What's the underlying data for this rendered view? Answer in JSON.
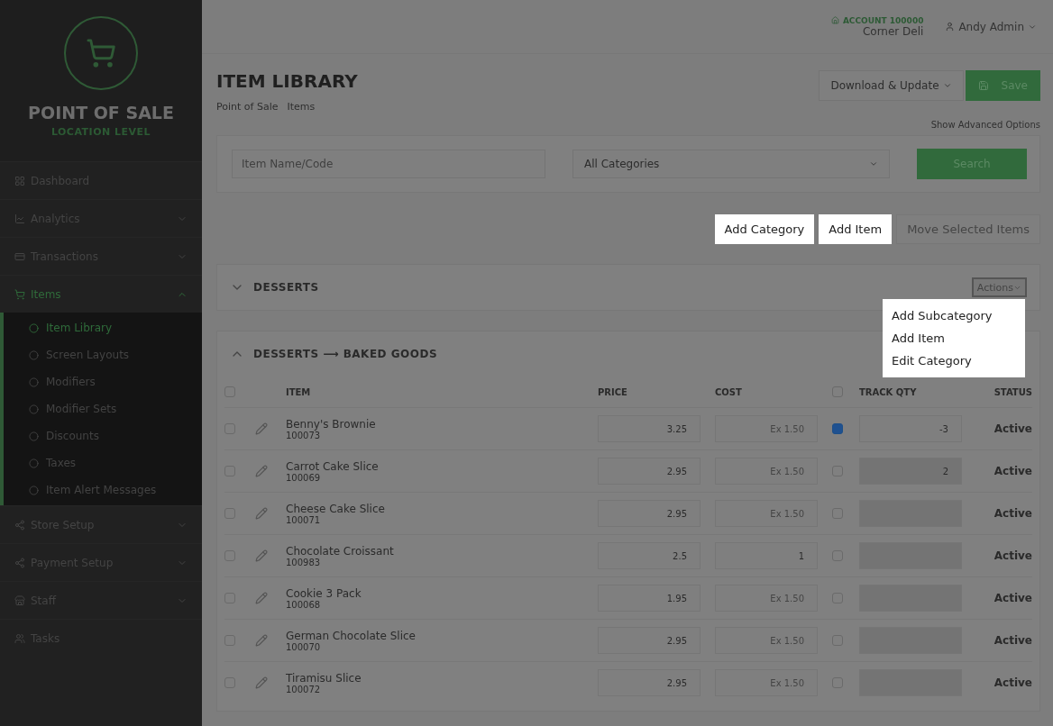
{
  "brand": {
    "title": "POINT OF SALE",
    "subtitle": "LOCATION LEVEL"
  },
  "sidebar": {
    "items": [
      {
        "label": "Dashboard",
        "selected": false
      },
      {
        "label": "Analytics",
        "selected": false,
        "expanded": false
      },
      {
        "label": "Transactions",
        "selected": false,
        "expanded": false
      },
      {
        "label": "Items",
        "selected": true,
        "expanded": true,
        "children": [
          {
            "label": "Item Library",
            "selected": true
          },
          {
            "label": "Screen Layouts",
            "selected": false
          },
          {
            "label": "Modifiers",
            "selected": false
          },
          {
            "label": "Modifier Sets",
            "selected": false
          },
          {
            "label": "Discounts",
            "selected": false
          },
          {
            "label": "Taxes",
            "selected": false
          },
          {
            "label": "Item Alert Messages",
            "selected": false
          }
        ]
      },
      {
        "label": "Store Setup",
        "selected": false,
        "expanded": false
      },
      {
        "label": "Payment Setup",
        "selected": false,
        "expanded": false
      },
      {
        "label": "Staff",
        "selected": false,
        "expanded": false
      },
      {
        "label": "Tasks",
        "selected": false
      }
    ]
  },
  "header": {
    "account": "ACCOUNT 100000",
    "store": "Corner Deli",
    "user": "Andy Admin"
  },
  "page": {
    "title": "ITEM LIBRARY",
    "breadcrumbs": [
      "Point of Sale",
      "Items"
    ],
    "download_button": "Download & Update",
    "save_button": "Save",
    "advanced_link": "Show Advanced Options"
  },
  "search": {
    "placeholder": "Item Name/Code",
    "category": "All Categories",
    "button": "Search"
  },
  "actions": [
    {
      "label": "Add Category",
      "highlighted": true,
      "disabled": false
    },
    {
      "label": "Add Item",
      "highlighted": true,
      "disabled": false
    },
    {
      "label": "Move Selected Items",
      "highlighted": false,
      "disabled": true
    }
  ],
  "categories": [
    {
      "title": "DESSERTS",
      "expanded": false,
      "actions_button": "Actions",
      "menu": [
        "Add Subcategory",
        "Add Item",
        "Edit Category"
      ]
    },
    {
      "title": "DESSERTS ⟶ BAKED GOODS",
      "expanded": true
    }
  ],
  "table": {
    "select_all_checked": false,
    "track_all_checked": false,
    "columns": [
      "ITEM",
      "PRICE",
      "COST",
      "TRACK QTY",
      "STATUS"
    ],
    "rows": [
      {
        "selected": false,
        "name": "Benny's Brownie",
        "code": "100073",
        "price": "3.25",
        "cost_placeholder": "Ex 1.50",
        "track": true,
        "qty": "-3",
        "status": "Active"
      },
      {
        "selected": false,
        "name": "Carrot Cake Slice",
        "code": "100069",
        "price": "2.95",
        "cost_placeholder": "Ex 1.50",
        "track": false,
        "qty": "2",
        "status": "Active"
      },
      {
        "selected": false,
        "name": "Cheese Cake Slice",
        "code": "100071",
        "price": "2.95",
        "cost_placeholder": "Ex 1.50",
        "track": false,
        "status": "Active"
      },
      {
        "selected": false,
        "name": "Chocolate Croissant",
        "code": "100983",
        "price": "2.5",
        "cost": "1",
        "track": false,
        "status": "Active"
      },
      {
        "selected": false,
        "name": "Cookie 3 Pack",
        "code": "100068",
        "price": "1.95",
        "cost_placeholder": "Ex 1.50",
        "track": false,
        "status": "Active"
      },
      {
        "selected": false,
        "name": "German Chocolate Slice",
        "code": "100070",
        "price": "2.95",
        "cost_placeholder": "Ex 1.50",
        "track": false,
        "status": "Active"
      },
      {
        "selected": false,
        "name": "Tiramisu Slice",
        "code": "100072",
        "price": "2.95",
        "cost_placeholder": "Ex 1.50",
        "track": false,
        "status": "Active"
      }
    ]
  }
}
